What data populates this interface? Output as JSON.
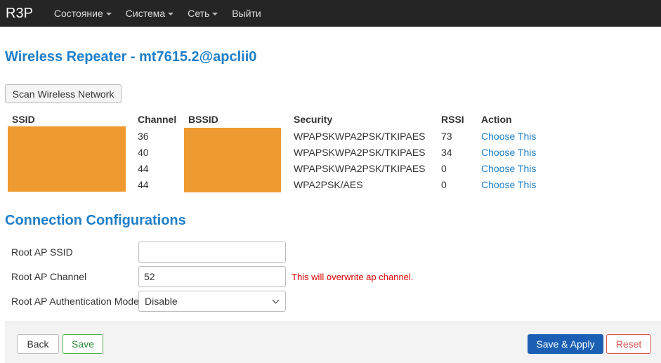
{
  "navbar": {
    "brand": "R3P",
    "items": [
      {
        "label": "Состояние",
        "has_caret": true
      },
      {
        "label": "Система",
        "has_caret": true
      },
      {
        "label": "Сеть",
        "has_caret": true
      },
      {
        "label": "Выйти",
        "has_caret": false
      }
    ]
  },
  "page_title": "Wireless Repeater - mt7615.2@apclii0",
  "scan_button": "Scan Wireless Network",
  "scan_table": {
    "headers": {
      "ssid": "SSID",
      "channel": "Channel",
      "bssid": "BSSID",
      "security": "Security",
      "rssi": "RSSI",
      "action": "Action"
    },
    "rows": [
      {
        "channel": "36",
        "security": "WPAPSKWPA2PSK/TKIPAES",
        "rssi": "73",
        "action": "Choose This"
      },
      {
        "channel": "40",
        "security": "WPAPSKWPA2PSK/TKIPAES",
        "rssi": "34",
        "action": "Choose This"
      },
      {
        "channel": "44",
        "security": "WPAPSKWPA2PSK/TKIPAES",
        "rssi": "0",
        "action": "Choose This"
      },
      {
        "channel": "44",
        "security": "WPA2PSK/AES",
        "rssi": "0",
        "action": "Choose This"
      }
    ],
    "redaction_color": "#ef9a30"
  },
  "connection": {
    "title": "Connection Configurations",
    "root_ssid": {
      "label": "Root AP SSID",
      "value": ""
    },
    "root_channel": {
      "label": "Root AP Channel",
      "value": "52",
      "warning": "This will overwrite ap channel."
    },
    "root_auth": {
      "label": "Root AP Authentication Mode",
      "value": "Disable"
    }
  },
  "footer": {
    "back": "Back",
    "save": "Save",
    "save_apply": "Save & Apply",
    "reset": "Reset"
  },
  "colors": {
    "accent": "#1f7ec8",
    "navbar_bg": "#252525",
    "primary_button": "#1a5fb4",
    "warning_text": "#d80000",
    "save_green": "#4caf50",
    "reset_red": "#d9534f"
  }
}
